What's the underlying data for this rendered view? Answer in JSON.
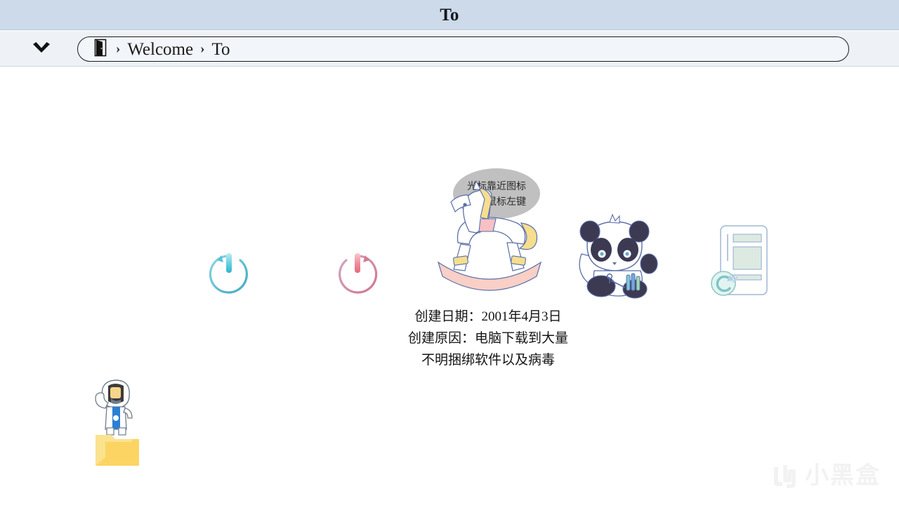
{
  "window": {
    "title": "To"
  },
  "addressbar": {
    "dropdown_icon": "chevron-down-icon",
    "location_icon": "door-open-icon",
    "separator": "›",
    "crumbs": [
      {
        "label": "Welcome"
      },
      {
        "label": "To"
      }
    ]
  },
  "desktop": {
    "icons": [
      {
        "name": "shutdown-restart-teal-icon",
        "label": "",
        "accent": "#4ec3d9"
      },
      {
        "name": "shutdown-restart-pink-icon",
        "label": "",
        "accent": "#e38396"
      },
      {
        "name": "rocking-horse-icon",
        "label": "",
        "accent": "#f6c8c0"
      },
      {
        "name": "panda-icon",
        "label": "",
        "accent": "#4a4a6a"
      },
      {
        "name": "document-refresh-icon",
        "label": "",
        "accent": "#9ac4c9"
      },
      {
        "name": "astronaut-folder-icon",
        "label": "",
        "accent": "#f7cf6a"
      }
    ],
    "tooltip": {
      "line1": "光标靠近图标",
      "line2": "点击鼠标左键",
      "bg": "#c0c0c0"
    },
    "caption": {
      "line1": "创建日期：2001年4月3日",
      "line2": "创建原因：电脑下载到大量",
      "line3": "不明捆绑软件以及病毒"
    }
  },
  "watermark": {
    "text": "小黑盒",
    "logo": "xiaoheihe-logo-icon",
    "color": "#f2f2f2"
  },
  "colors": {
    "titlebar_bg": "#ccdaea",
    "addressbar_bg": "#eef2f7",
    "canvas_bg": "#ffffff",
    "text": "#141414"
  }
}
